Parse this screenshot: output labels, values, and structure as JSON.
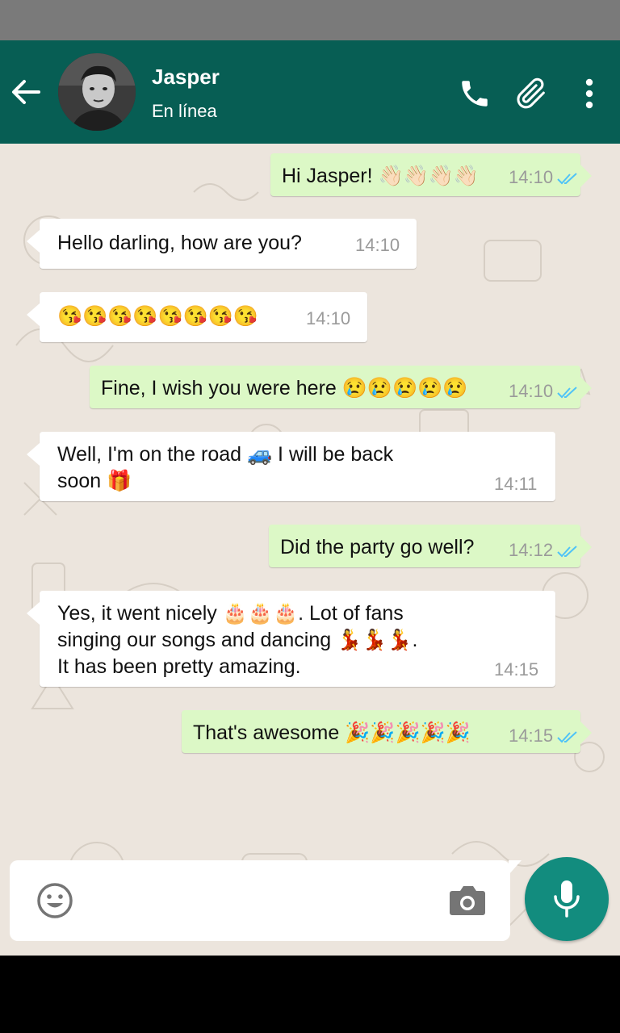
{
  "contact": {
    "name": "Jasper",
    "status": "En línea"
  },
  "colors": {
    "header": "#075e54",
    "outgoing": "#dcf8c6",
    "incoming": "#ffffff",
    "accent": "#128c7e",
    "tick": "#4fc3f7"
  },
  "header_icons": [
    "back-arrow-icon",
    "phone-icon",
    "paperclip-icon",
    "more-vert-icon"
  ],
  "messages": [
    {
      "dir": "out",
      "text": "Hi Jasper! 👋🏻👋🏻👋🏻👋🏻",
      "time": "14:10"
    },
    {
      "dir": "in",
      "text": "Hello darling, how are you?",
      "time": "14:10"
    },
    {
      "dir": "in",
      "text": "😘😘😘😘😘😘😘😘",
      "time": "14:10"
    },
    {
      "dir": "out",
      "text": "Fine, I wish you were here 😢😢😢😢😢",
      "time": "14:10"
    },
    {
      "dir": "in",
      "text": "Well, I'm on the road 🚙 I will be back\nsoon 🎁",
      "time": "14:11"
    },
    {
      "dir": "out",
      "text": "Did the party go well?",
      "time": "14:12"
    },
    {
      "dir": "in",
      "text": "Yes, it went nicely 🎂🎂🎂. Lot of fans\nsinging our songs and dancing 💃💃💃.\nIt has been pretty amazing.",
      "time": "14:15"
    },
    {
      "dir": "out",
      "text": "That's awesome 🎉🎉🎉🎉🎉",
      "time": "14:15"
    }
  ],
  "composer": {
    "value": "",
    "icons": [
      "emoji-icon",
      "camera-icon",
      "microphone-icon"
    ]
  }
}
